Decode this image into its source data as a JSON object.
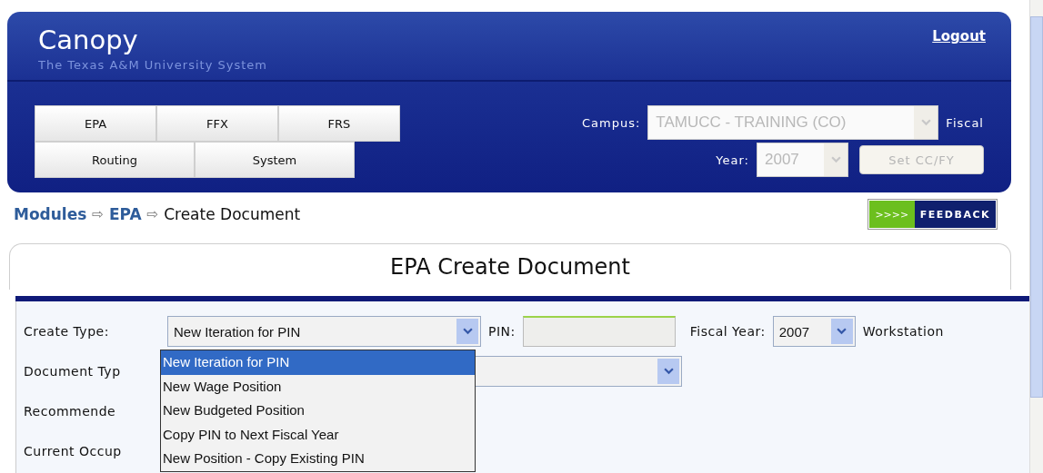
{
  "header": {
    "title": "Canopy",
    "subtitle": "The Texas A&M University System",
    "logout": "Logout",
    "tab_rows": [
      {
        "tabs": [
          {
            "label": "EPA"
          },
          {
            "label": "FFX"
          },
          {
            "label": "FRS"
          }
        ]
      },
      {
        "tabs": [
          {
            "label": "Routing"
          },
          {
            "label": "System"
          }
        ]
      }
    ],
    "campus": {
      "label": "Campus:",
      "value": "TAMUCC - TRAINING (CO)",
      "disabled": true
    },
    "fiscal_label_lines": [
      "Fiscal",
      "Year:"
    ],
    "fiscal_year": {
      "value": "2007",
      "disabled": true
    },
    "set_button": {
      "label": "Set CC/FY",
      "disabled": true
    }
  },
  "breadcrumb": [
    {
      "kind": "link",
      "label": "Modules"
    },
    {
      "kind": "separator",
      "label": "⇨"
    },
    {
      "kind": "link",
      "label": "EPA"
    },
    {
      "kind": "separator",
      "label": "⇨"
    },
    {
      "kind": "current",
      "label": "Create Document"
    }
  ],
  "feedback": {
    "arrows": ">>>>",
    "label": "FEEDBACK"
  },
  "panel": {
    "title": "EPA Create Document"
  },
  "form": {
    "create_type": {
      "label": "Create Type:",
      "value": "New Iteration for PIN",
      "expanded": true,
      "options": [
        {
          "label": "New Iteration for PIN",
          "selected": true
        },
        {
          "label": "New Wage Position",
          "selected": false
        },
        {
          "label": "New Budgeted Position",
          "selected": false
        },
        {
          "label": "Copy PIN to Next Fiscal Year",
          "selected": false
        },
        {
          "label": "New Position - Copy Existing PIN",
          "selected": false
        }
      ]
    },
    "pin": {
      "label": "PIN:"
    },
    "fiscal_year": {
      "label": "Fiscal Year:",
      "value": "2007"
    },
    "workstation_label": "Workstation",
    "document_type_label": "Document Typ",
    "recommended_label": "Recommende",
    "current_occupant_label": "Current Occup"
  }
}
